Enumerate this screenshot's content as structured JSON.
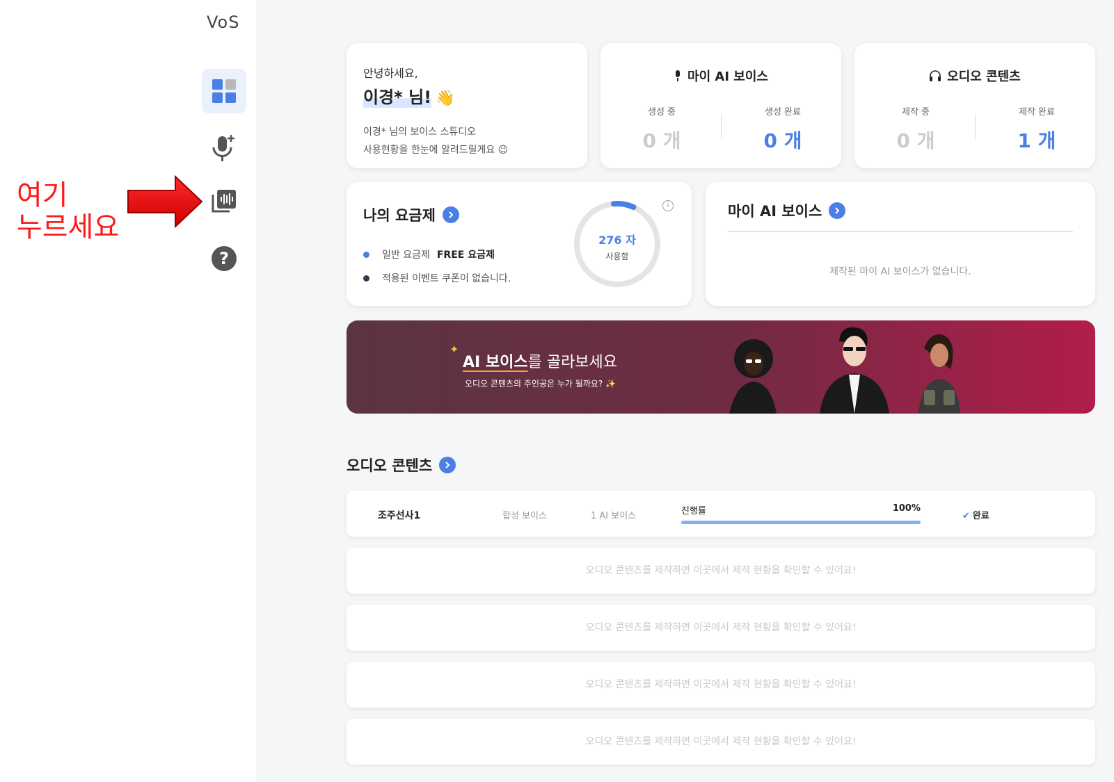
{
  "sidebar": {
    "logo": "VoS",
    "nav": [
      {
        "name": "dashboard",
        "icon": "dashboard-icon",
        "active": true
      },
      {
        "name": "voice-create",
        "icon": "mic-plus-icon",
        "active": false
      },
      {
        "name": "audio-content",
        "icon": "audio-library-icon",
        "active": false
      },
      {
        "name": "help",
        "icon": "help-icon",
        "active": false
      }
    ]
  },
  "annotation": {
    "line1": "여기",
    "line2": "누르세요",
    "color": "#ff1a1a"
  },
  "greeting": {
    "hello": "안녕하세요,",
    "name": "이경* 님!",
    "emoji": "👋",
    "desc1": "이경* 님의 보이스 스튜디오",
    "desc2": "사용현황을 한눈에 알려드릴게요 😉"
  },
  "stats": {
    "voice": {
      "title": "마이 AI 보이스",
      "icon": "mic-icon",
      "left_label": "생성 중",
      "left_value": "0 개",
      "right_label": "생성 완료",
      "right_value": "0 개"
    },
    "audio": {
      "title": "오디오 콘텐츠",
      "icon": "headphones-icon",
      "left_label": "제작 중",
      "left_value": "0 개",
      "right_label": "제작 완료",
      "right_value": "1 개"
    }
  },
  "plan": {
    "title": "나의 요금제",
    "item1_label": "일반 요금제",
    "item1_value": "FREE 요금제",
    "item2_label": "적용된 이벤트 쿠폰이 없습니다.",
    "usage_value": "276 자",
    "usage_label": "사용함",
    "usage_fraction": 0.08,
    "info_icon": "ⓘ"
  },
  "my_voice": {
    "title": "마이 AI 보이스",
    "empty": "제작된 마이 AI 보이스가 없습니다."
  },
  "banner": {
    "headline_bold": "AI 보이스",
    "headline_rest": "를 골라보세요",
    "sub": "오디오 콘텐츠의 주인공은 누가 될까요? ✨",
    "sparkle": "✨"
  },
  "audio": {
    "title": "오디오 콘텐츠",
    "item": {
      "title": "조주선사1",
      "type": "합성 보이스",
      "voice": "1 AI 보이스",
      "progress_label": "진행률",
      "progress_text": "100%",
      "progress_value": 1.0,
      "status": "완료",
      "check": "✔"
    },
    "empty_message": "오디오 콘텐츠를 제작하면 이곳에서 제작 현황을 확인할 수 있어요!"
  },
  "colors": {
    "accent": "#4a7fe5",
    "progress": "#7fb2ee"
  }
}
